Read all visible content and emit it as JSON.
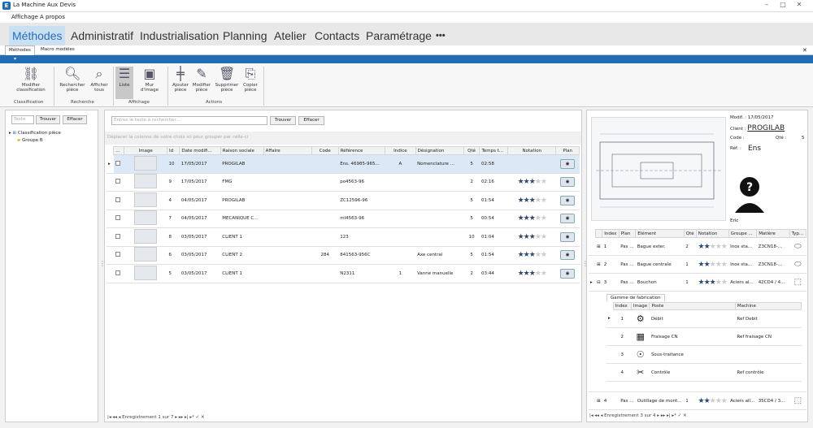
{
  "window": {
    "title": "La Machine Aux Devis",
    "logo": "E"
  },
  "menu": [
    "Affichage",
    "A propos"
  ],
  "nav": [
    "Méthodes",
    "Administratif",
    "Industrialisation",
    "Planning",
    "Atelier",
    "Contacts",
    "Paramétrage",
    "•••"
  ],
  "subtabs": [
    "Méthodes",
    "Macro modèles"
  ],
  "ribbon": {
    "buttons": [
      {
        "label": "Modifier classification",
        "icon": "hierarchy-icon"
      },
      {
        "label": "Rechercher pièce",
        "icon": "magnifier-icon"
      },
      {
        "label": "Afficher tous",
        "icon": "magnifier-clear-icon"
      },
      {
        "label": "Liste",
        "icon": "list-icon"
      },
      {
        "label": "Mur d'image",
        "icon": "image-wall-icon"
      },
      {
        "label": "Ajouter pièce",
        "icon": "add-icon"
      },
      {
        "label": "Modifier pièce",
        "icon": "pencil-icon"
      },
      {
        "label": "Supprimer pièce",
        "icon": "trash-icon"
      },
      {
        "label": "Copier pièce",
        "icon": "copy-icon"
      }
    ],
    "groups": [
      "Classification",
      "Recherche",
      "Affichage",
      "Actions"
    ]
  },
  "left": {
    "search_placeholder": "Texte",
    "find": "Trouver",
    "clear": "Effacer",
    "tree": [
      "Classification pièce",
      "Groupe B"
    ]
  },
  "mid": {
    "search_placeholder": "Entrez le texte à rechercher...",
    "find": "Trouver",
    "clear": "Effacer",
    "group_hint": "Déplacer la colonne de votre choix ici pour grouper par celle-ci",
    "columns": [
      "...",
      "Image",
      "Id",
      "Date modifi...",
      "Raison sociale",
      "Affaire",
      "Code",
      "Référence",
      "Indice",
      "Désignation",
      "Qté",
      "Temps t...",
      "Notation",
      "Plan"
    ],
    "rows": [
      {
        "id": "10",
        "date": "17/05/2017",
        "raison": "PROGILAB",
        "affaire": "",
        "code": "",
        "ref": "Ens. 46985-965...",
        "indice": "A",
        "desig": "Nomenclature ...",
        "qte": "5",
        "temps": "02:58",
        "stars": 0
      },
      {
        "id": "9",
        "date": "17/05/2017",
        "raison": "FMG",
        "affaire": "",
        "code": "",
        "ref": "po4563-96",
        "indice": "",
        "desig": "",
        "qte": "2",
        "temps": "02:16",
        "stars": 3
      },
      {
        "id": "4",
        "date": "04/05/2017",
        "raison": "PROGILAB",
        "affaire": "",
        "code": "",
        "ref": "ZC12596-96",
        "indice": "",
        "desig": "",
        "qte": "5",
        "temps": "01:54",
        "stars": 3
      },
      {
        "id": "7",
        "date": "04/05/2017",
        "raison": "MECANIQUE C...",
        "affaire": "",
        "code": "",
        "ref": "ml4563-96",
        "indice": "",
        "desig": "",
        "qte": "5",
        "temps": "00:54",
        "stars": 3
      },
      {
        "id": "8",
        "date": "03/05/2017",
        "raison": "CLIENT 1",
        "affaire": "",
        "code": "",
        "ref": "123",
        "indice": "",
        "desig": "",
        "qte": "10",
        "temps": "01:04",
        "stars": 3
      },
      {
        "id": "6",
        "date": "03/05/2017",
        "raison": "CLIENT 2",
        "affaire": "",
        "code": "284",
        "ref": "841563-956C",
        "indice": "",
        "desig": "Axe central",
        "qte": "5",
        "temps": "01:54",
        "stars": 3
      },
      {
        "id": "5",
        "date": "03/05/2017",
        "raison": "CLIENT 1",
        "affaire": "",
        "code": "",
        "ref": "N2311",
        "indice": "1",
        "desig": "Vanne manuelle",
        "qte": "2",
        "temps": "03:44",
        "stars": 3
      }
    ],
    "footer": "Enregistrement 1 sur 7"
  },
  "right": {
    "modif_label": "Modif. :",
    "modif_value": "17/05/2017",
    "client_label": "Client :",
    "client_value": "PROGILAB",
    "code_label": "Code :",
    "qte_label": "Qté :",
    "qte_value": "5",
    "ref_label": "Réf. :",
    "ref_value": "Ens",
    "user": "Eric",
    "columns": [
      "Index",
      "Plan",
      "Elément",
      "Qté",
      "Notation",
      "Groupe ...",
      "Matière",
      "Typ..."
    ],
    "rows": [
      {
        "index": "1",
        "plan": "Pas ...",
        "elem": "Bague exter.",
        "qte": "2",
        "stars": 2,
        "groupe": "Inox sta...",
        "matiere": "Z3CN18-..."
      },
      {
        "index": "2",
        "plan": "Pas ...",
        "elem": "Bague centrale",
        "qte": "1",
        "stars": 2,
        "groupe": "Inox sta...",
        "matiere": "Z3CN18-..."
      },
      {
        "index": "3",
        "plan": "Pas ...",
        "elem": "Bouchon",
        "qte": "1",
        "stars": 3,
        "groupe": "Aciers al...",
        "matiere": "42CD4 / 4..."
      },
      {
        "index": "4",
        "plan": "Pas ...",
        "elem": "Outillage de mont...",
        "qte": "1",
        "stars": 2,
        "groupe": "Aciers all...",
        "matiere": "35CD4 / 3..."
      }
    ],
    "gamme_tab": "Gamme de fabrication",
    "gamme_columns": [
      "Index",
      "Image",
      "Poste",
      "Machine"
    ],
    "gamme_rows": [
      {
        "index": "1",
        "poste": "Débit",
        "machine": "Ref Debit",
        "icon": "saw-icon"
      },
      {
        "index": "2",
        "poste": "Fraisage CN",
        "machine": "Ref fraisage CN",
        "icon": "cnc-icon"
      },
      {
        "index": "3",
        "poste": "Sous-traitance",
        "machine": "",
        "icon": "handshake-icon"
      },
      {
        "index": "4",
        "poste": "Contrôle",
        "machine": "Ref contrôle",
        "icon": "caliper-icon"
      }
    ],
    "footer": "Enregistrement 3 sur 4"
  }
}
